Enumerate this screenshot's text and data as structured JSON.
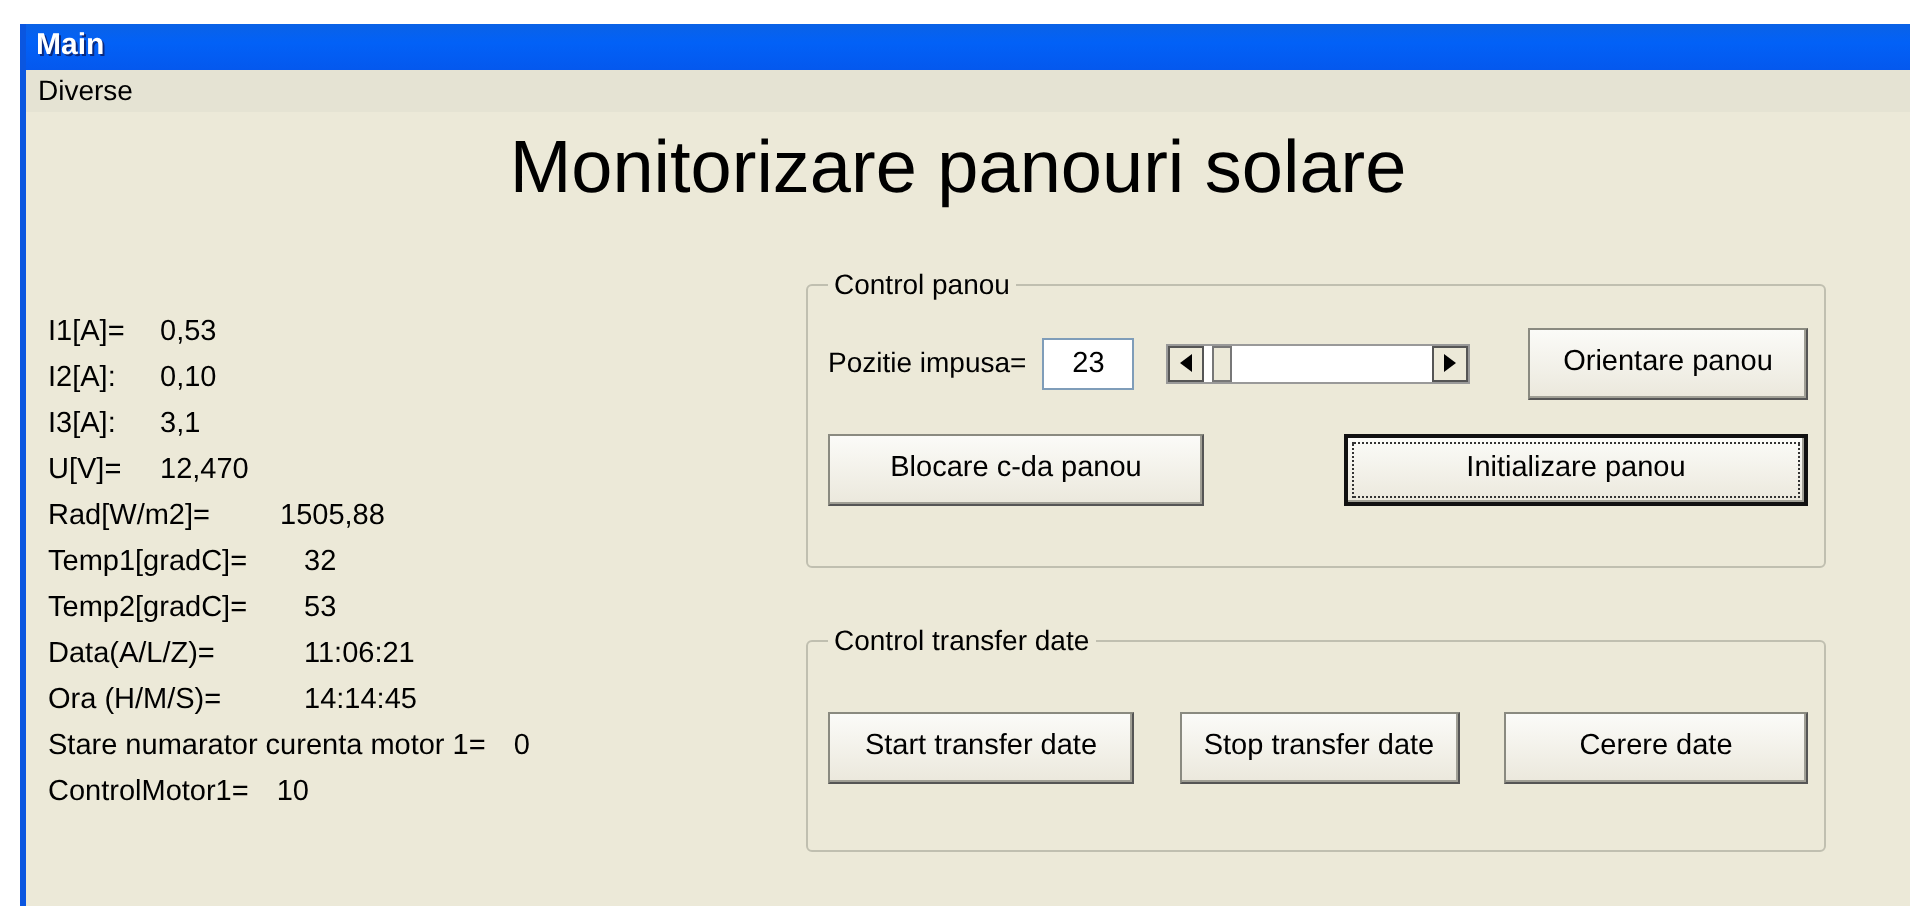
{
  "window": {
    "title": "Main"
  },
  "menu": [
    "Diverse"
  ],
  "heading": "Monitorizare panouri solare",
  "readings": [
    {
      "label": "I1[A]=",
      "value": "0,53",
      "kind": "short"
    },
    {
      "label": "I2[A]:",
      "value": "0,10",
      "kind": "short"
    },
    {
      "label": "I3[A]:",
      "value": "3,1",
      "kind": "short"
    },
    {
      "label": "U[V]=",
      "value": "12,470",
      "kind": "short"
    },
    {
      "label": "Rad[W/m2]=",
      "value": "1505,88",
      "kind": "mid"
    },
    {
      "label": "Temp1[gradC]=",
      "value": "32",
      "kind": "long"
    },
    {
      "label": "Temp2[gradC]=",
      "value": "53",
      "kind": "long"
    },
    {
      "label": "Data(A/L/Z)=",
      "value": "11:06:21",
      "kind": "long"
    },
    {
      "label": "Ora (H/M/S)=",
      "value": "14:14:45",
      "kind": "long"
    },
    {
      "label": "Stare numarator curenta motor 1=",
      "value": "0",
      "kind": "inline"
    },
    {
      "label": "ControlMotor1=",
      "value": "10",
      "kind": "inline"
    }
  ],
  "panel_control": {
    "title": "Control panou",
    "position_label": "Pozitie impusa=",
    "position_value": "23",
    "slider": {
      "level": 0.04
    },
    "buttons": [
      {
        "label": "Orientare panou",
        "focused": false
      },
      {
        "label": "Blocare c-da panou",
        "focused": false
      },
      {
        "label": "Initializare panou",
        "focused": true
      }
    ]
  },
  "panel_transfer": {
    "title": "Control transfer date",
    "buttons": [
      {
        "label": "Start transfer date",
        "focused": false
      },
      {
        "label": "Stop transfer date",
        "focused": false
      },
      {
        "label": "Cerere date",
        "focused": false
      }
    ]
  }
}
